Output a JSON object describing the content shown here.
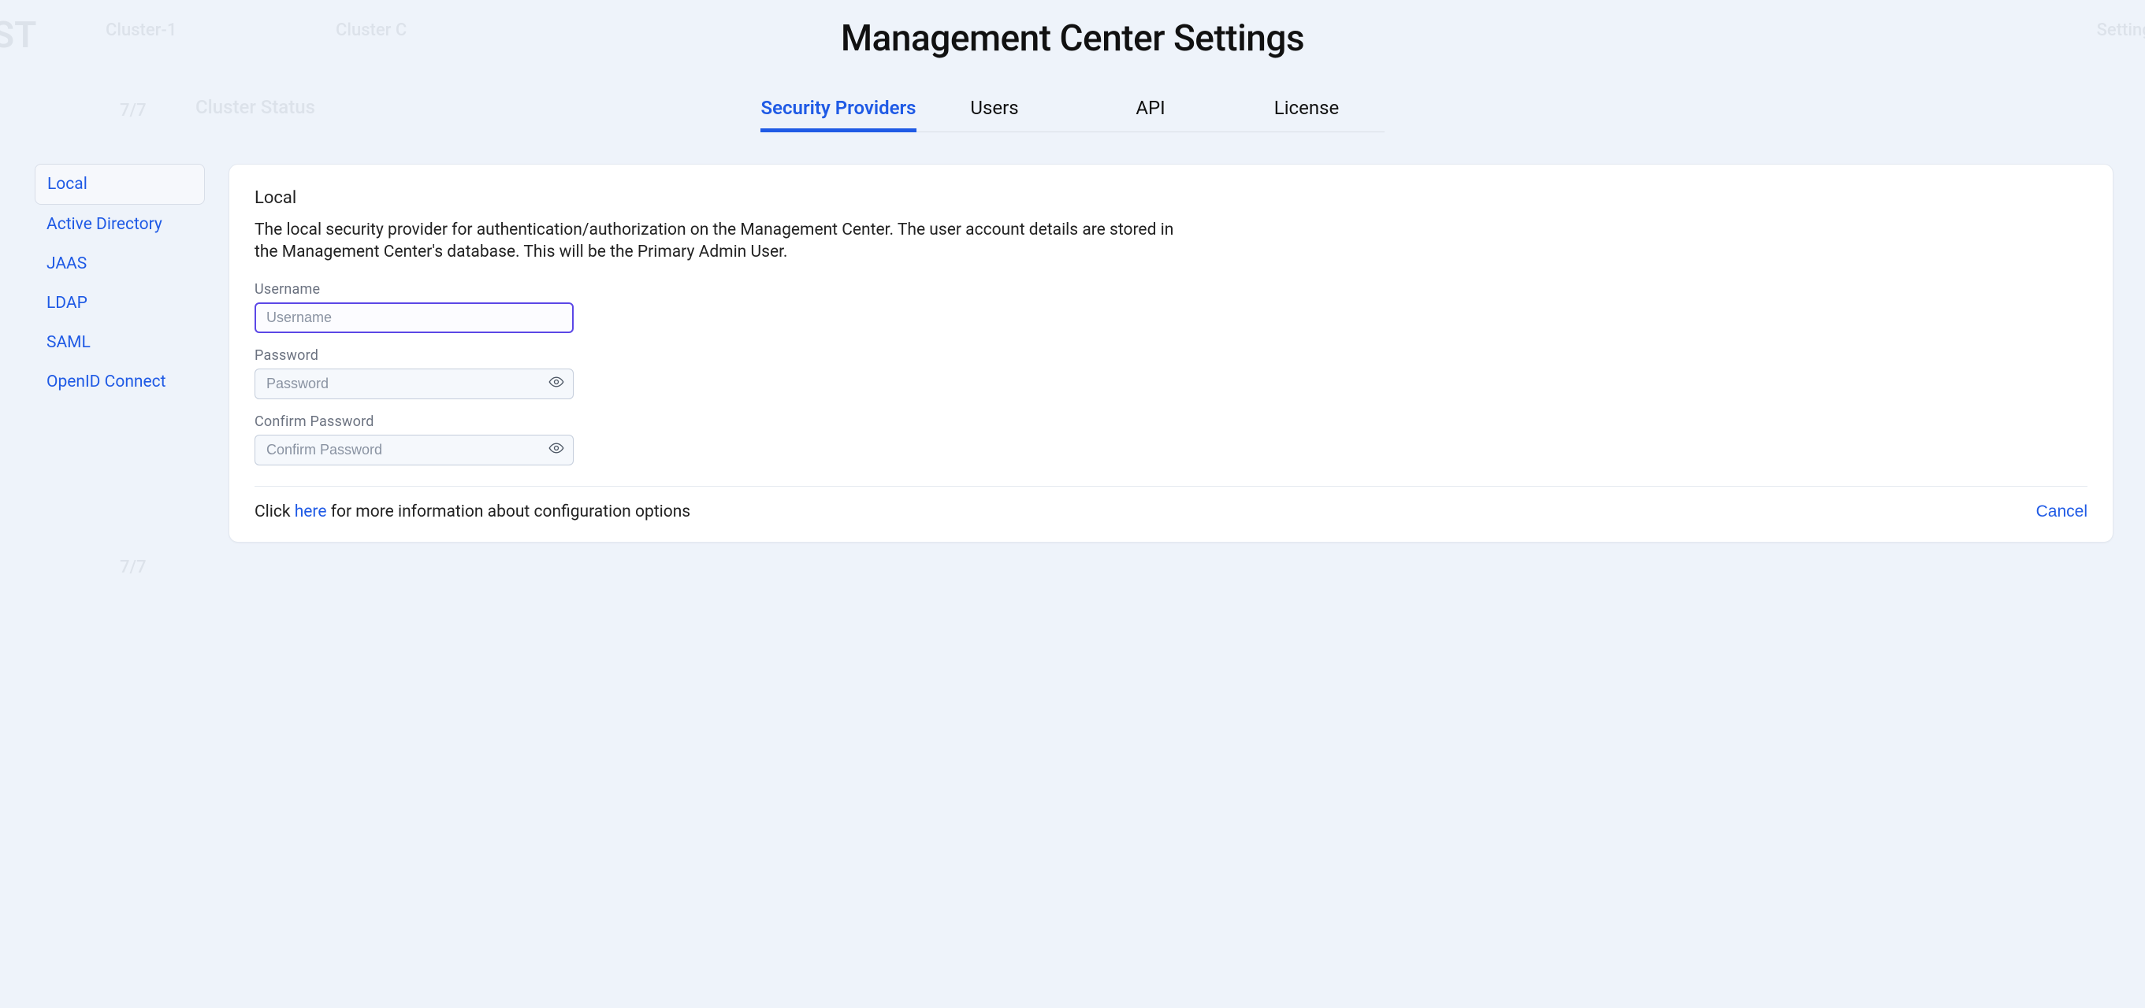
{
  "bg": {
    "brand": "ST",
    "cluster_label": "Cluster-1",
    "cluster_settings": "Cluster C",
    "settings_label": "Settings",
    "status_label": "Cluster Status",
    "ratio": "7/7"
  },
  "title": "Management Center Settings",
  "tabs": [
    {
      "key": "security",
      "label": "Security Providers",
      "active": true
    },
    {
      "key": "users",
      "label": "Users",
      "active": false
    },
    {
      "key": "api",
      "label": "API",
      "active": false
    },
    {
      "key": "license",
      "label": "License",
      "active": false
    }
  ],
  "sidebar": {
    "items": [
      {
        "key": "local",
        "label": "Local",
        "active": true
      },
      {
        "key": "ad",
        "label": "Active Directory",
        "active": false
      },
      {
        "key": "jaas",
        "label": "JAAS",
        "active": false
      },
      {
        "key": "ldap",
        "label": "LDAP",
        "active": false
      },
      {
        "key": "saml",
        "label": "SAML",
        "active": false
      },
      {
        "key": "oidc",
        "label": "OpenID Connect",
        "active": false
      }
    ]
  },
  "panel": {
    "title": "Local",
    "description": "The local security provider for authentication/authorization on the Management Center. The user account details are stored in the Management Center's database. This will be the Primary Admin User.",
    "fields": {
      "username": {
        "label": "Username",
        "placeholder": "Username",
        "value": ""
      },
      "password": {
        "label": "Password",
        "placeholder": "Password",
        "value": ""
      },
      "confirm": {
        "label": "Confirm Password",
        "placeholder": "Confirm Password",
        "value": ""
      }
    },
    "info_prefix": "Click ",
    "info_link": "here",
    "info_suffix": " for more information about configuration options",
    "cancel": "Cancel"
  }
}
